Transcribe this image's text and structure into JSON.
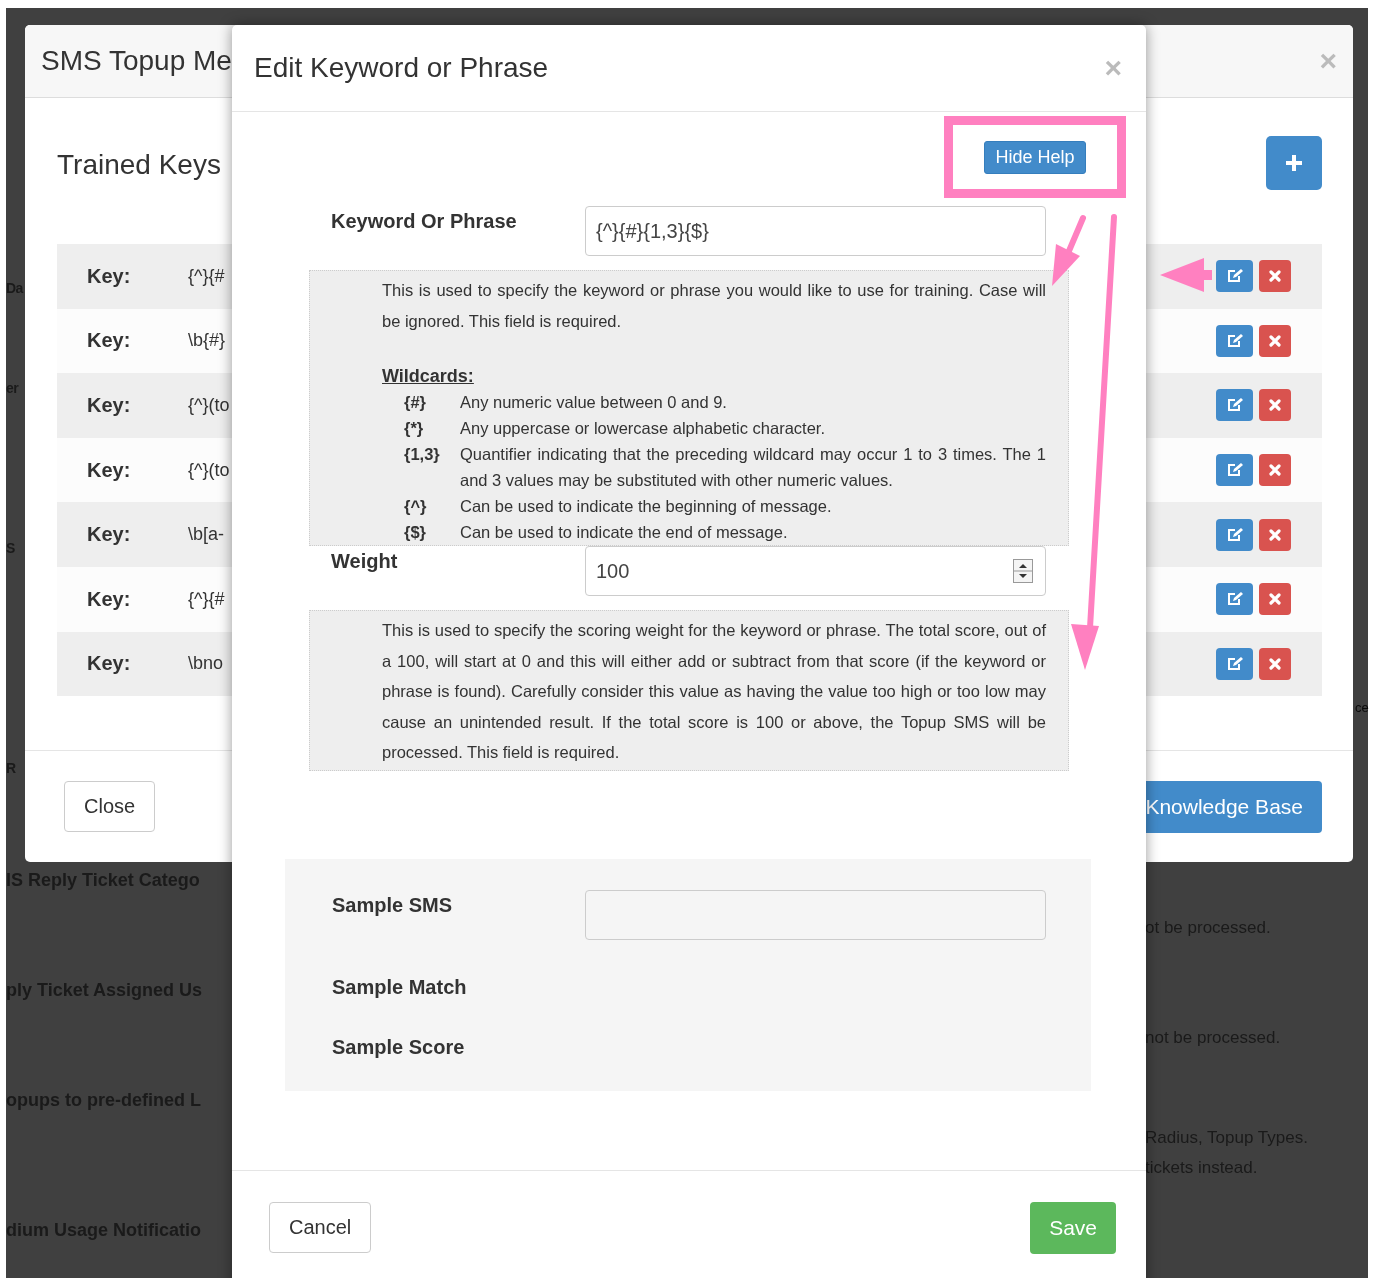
{
  "background": {
    "left_fragments": [
      "Da",
      "er",
      "S",
      "R",
      "IS Reply Ticket Catego",
      "ply Ticket Assigned Us",
      "opups to pre-defined L",
      "dium Usage Notificatio"
    ],
    "right_fragments": [
      "ce",
      "ot be processed.",
      "not be processed.",
      "Radius, Topup Types.",
      "tickets instead."
    ]
  },
  "back_modal": {
    "title": "SMS Topup Me",
    "close": "×",
    "heading": "Trained Keys",
    "keys": [
      {
        "label": "Key:",
        "value": "{^}{#"
      },
      {
        "label": "Key:",
        "value": "\\b{#}"
      },
      {
        "label": "Key:",
        "value": "{^}(to"
      },
      {
        "label": "Key:",
        "value": "{^}(to"
      },
      {
        "label": "Key:",
        "value": "\\b[a-"
      },
      {
        "label": "Key:",
        "value": "{^}{#"
      },
      {
        "label": "Key:",
        "value": "\\bno"
      }
    ],
    "close_button": "Close",
    "primary_button": "Knowledge Base"
  },
  "front_modal": {
    "title": "Edit Keyword or Phrase",
    "close": "×",
    "help_button": "Hide Help",
    "fields": [
      {
        "kind": "text",
        "label": "Keyword Or Phrase",
        "value": "{^}{#}{1,3}{$}",
        "help": "This is used to specify the keyword or phrase you would like to use for training. Case will be ignored. This field is required.",
        "wildcards_heading": "Wildcards:",
        "wildcards": [
          {
            "token": "{#}",
            "description": "Any numeric value between 0 and 9."
          },
          {
            "token": "{*}",
            "description": "Any uppercase or lowercase alphabetic character."
          },
          {
            "token": "{1,3}",
            "description": "Quantifier indicating that the preceding wildcard may occur 1 to 3 times. The 1 and 3 values may be substituted with other numeric values."
          },
          {
            "token": "{^}",
            "description": "Can be used to indicate the beginning of message."
          },
          {
            "token": "{$}",
            "description": "Can be used to indicate the end of message."
          }
        ]
      },
      {
        "kind": "number",
        "label": "Weight",
        "value": "100",
        "help": "This is used to specify the scoring weight for the keyword or phrase. The total score, out of a 100, will start at 0 and this will either add or subtract from that score (if the keyword or phrase is found). Carefully consider this value as having the value too high or too low may cause an unintended result. If the total score is 100 or above, the Topup SMS will be processed. This field is required."
      }
    ],
    "sample": [
      {
        "kind": "input",
        "label": "Sample SMS"
      },
      {
        "kind": "output",
        "label": "Sample Match"
      },
      {
        "kind": "output",
        "label": "Sample Score"
      }
    ],
    "cancel_button": "Cancel",
    "save_button": "Save"
  }
}
